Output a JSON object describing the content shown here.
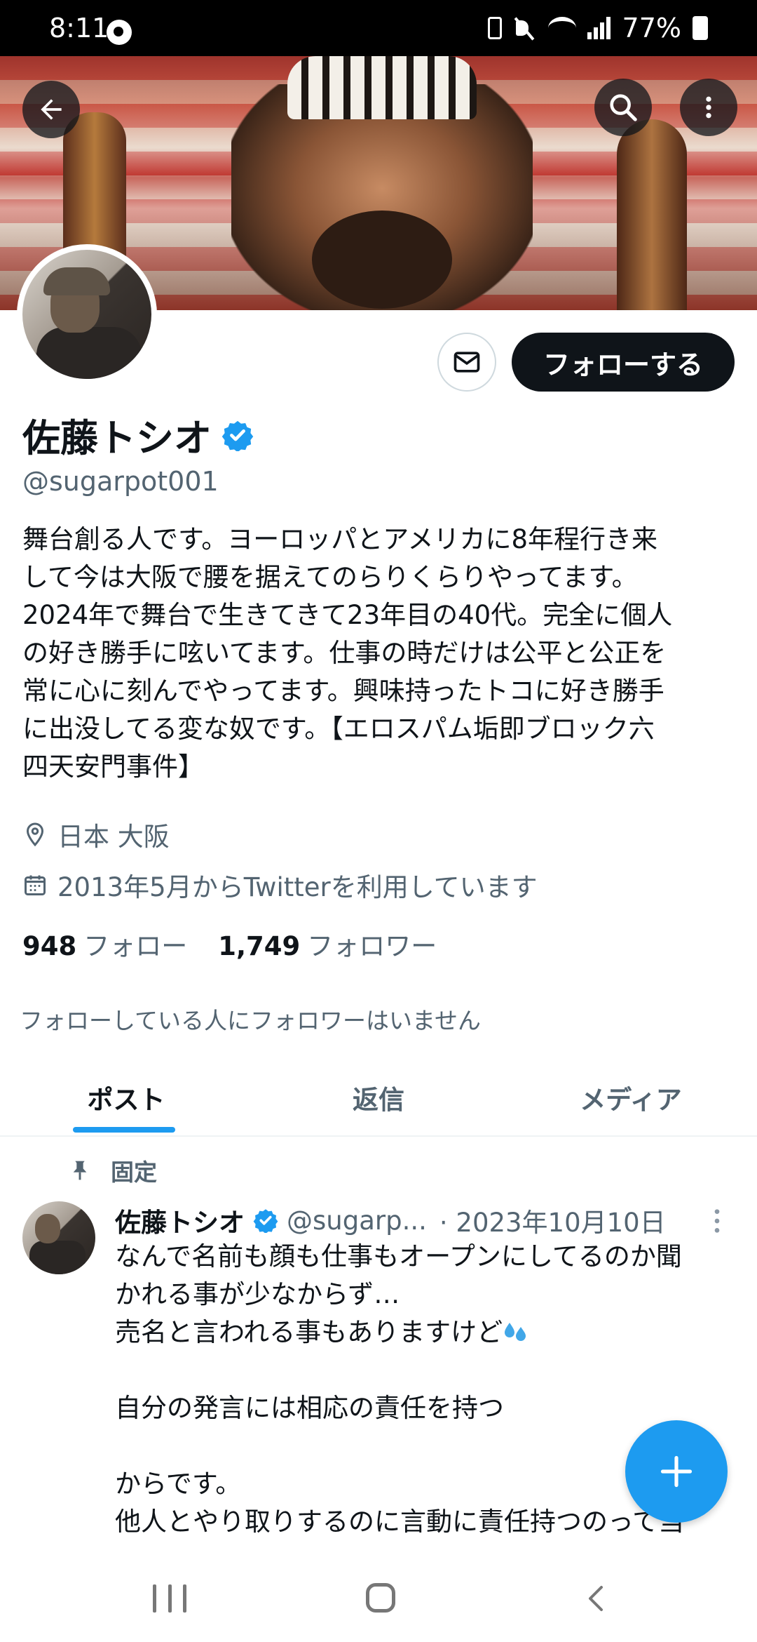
{
  "status_bar": {
    "time": "8:11",
    "battery": "77%"
  },
  "header": {
    "icons": [
      "back-arrow-icon",
      "search-icon",
      "more-vertical-icon"
    ]
  },
  "profile": {
    "display_name": "佐藤トシオ",
    "handle": "@sugarpot001",
    "follow_label": "フォローする",
    "bio": "舞台創る人です。ヨーロッパとアメリカに8年程行き来\nして今は大阪で腰を据えてのらりくらりやってます。\n2024年で舞台で生きてきて23年目の40代。完全に個人\nの好き勝手に呟いてます。仕事の時だけは公平と公正を\n常に心に刻んでやってます。興味持ったトコに好き勝手\nに出没してる変な奴です。【エロスパム垢即ブロック六\n四天安門事件】",
    "location": "日本 大阪",
    "joined": "2013年5月からTwitterを利用しています",
    "following_count": "948",
    "following_label": "フォロー",
    "followers_count": "1,749",
    "followers_label": "フォロワー",
    "followers_note": "フォローしている人にフォロワーはいません"
  },
  "tabs": [
    {
      "label": "ポスト",
      "active": true
    },
    {
      "label": "返信",
      "active": false
    },
    {
      "label": "メディア",
      "active": false
    }
  ],
  "pinned_post": {
    "pinned_label": "固定",
    "author_name": "佐藤トシオ",
    "author_handle": "@sugarp...",
    "date": "· 2023年10月10日",
    "text_part1": "なんで名前も顔も仕事もオープンにしてるのか聞\nかれる事が少なからず…\n売名と言われる事もありますけど",
    "text_part2": "\n\n自分の発言には相応の責任を持つ\n\nからです。\n他人とやり取りするのに言動に責任持つのって当"
  },
  "colors": {
    "accent": "#1d9bf0",
    "text": "#0f1419",
    "muted": "#536471",
    "border": "#cfd9de"
  }
}
